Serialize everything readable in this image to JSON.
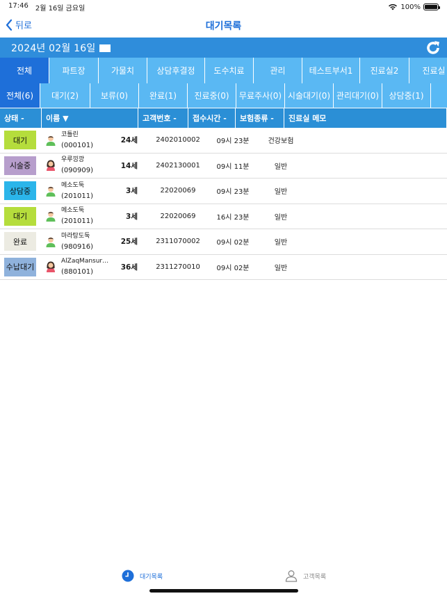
{
  "status_bar": {
    "time": "17:46",
    "date": "2월 16일 금요일",
    "battery": "100%"
  },
  "nav": {
    "back_label": "뒤로",
    "title": "대기목록"
  },
  "date_bar": {
    "date": "2024년 02월 16일"
  },
  "dept_tabs": [
    "전체",
    "파트장",
    "가물치",
    "상담후결정",
    "도수치료",
    "관리",
    "테스트부서1",
    "진료실2",
    "진료실"
  ],
  "status_tabs": [
    "전체(6)",
    "대기(2)",
    "보류(0)",
    "완료(1)",
    "진료중(0)",
    "무료주사(0)",
    "시술대기(0)",
    "관리대기(0)",
    "상담중(1)"
  ],
  "table_headers": [
    "상태 -",
    "이름 ▼",
    "고객번호 -",
    "접수시간 -",
    "보험종류 -",
    "진료실 메모"
  ],
  "rows": [
    {
      "status": "대기",
      "status_color": "#b5dd3c",
      "name": "코틀린",
      "code": "(000101)",
      "age": "24세",
      "customer_no": "2402010002",
      "time": "09시 23분",
      "insurance": "건강보험",
      "gender": "male"
    },
    {
      "status": "시술중",
      "status_color": "#b79ecc",
      "name": "우루낑깡",
      "code": "(090909)",
      "age": "14세",
      "customer_no": "2402130001",
      "time": "09시 11분",
      "insurance": "일반",
      "gender": "female"
    },
    {
      "status": "상담중",
      "status_color": "#2bb5ea",
      "name": "메소도둑",
      "code": "(201011)",
      "age": "3세",
      "customer_no": "22020069",
      "time": "09시 23분",
      "insurance": "일반",
      "gender": "male"
    },
    {
      "status": "대기",
      "status_color": "#b5dd3c",
      "name": "메소도둑",
      "code": "(201011)",
      "age": "3세",
      "customer_no": "22020069",
      "time": "16시 23분",
      "insurance": "일반",
      "gender": "male"
    },
    {
      "status": "완료",
      "status_color": "#ecebe2",
      "name": "마라탕도둑",
      "code": "(980916)",
      "age": "25세",
      "customer_no": "2311070002",
      "time": "09시 02분",
      "insurance": "일반",
      "gender": "male"
    },
    {
      "status": "수납대기",
      "status_color": "#8fb2dc",
      "name": "AlZaqMansuruQat...",
      "code": "(880101)",
      "age": "36세",
      "customer_no": "2311270010",
      "time": "09시 02분",
      "insurance": "일반",
      "gender": "female"
    }
  ],
  "tab_bar": {
    "waiting_label": "대기목록",
    "customers_label": "고객목록"
  },
  "colors": {
    "accent": "#1e6fd9",
    "bar": "#2f8ddb",
    "tab": "#5ab8f3"
  }
}
